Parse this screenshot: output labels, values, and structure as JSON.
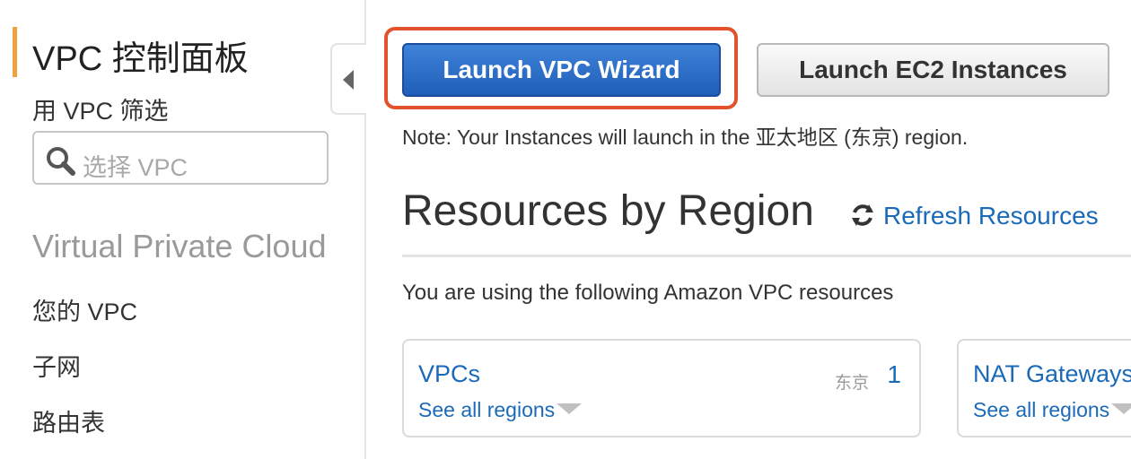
{
  "sidebar": {
    "title": "VPC 控制面板",
    "filter_label": "用 VPC 筛选",
    "filter_placeholder": "选择 VPC",
    "section_heading": "Virtual Private Cloud",
    "items": [
      {
        "label": "您的 VPC"
      },
      {
        "label": "子网"
      },
      {
        "label": "路由表"
      }
    ]
  },
  "main": {
    "launch_wizard_label": "Launch VPC Wizard",
    "launch_ec2_label": "Launch EC2 Instances",
    "note": "Note: Your Instances will launch in the 亚太地区 (东京) region.",
    "region_heading": "Resources by Region",
    "refresh_label": "Refresh Resources",
    "using_text": "You are using the following Amazon VPC resources",
    "cards": [
      {
        "title": "VPCs",
        "link": "See all regions",
        "region": "东京",
        "count": "1"
      },
      {
        "title": "NAT Gateways",
        "link": "See all regions"
      }
    ]
  },
  "colors": {
    "accent": "#f0a040",
    "primary_button": "#2a6ecb",
    "highlight": "#e2522c",
    "link": "#1a6ab8"
  },
  "icons": [
    "search-icon",
    "collapse-chevron-icon",
    "refresh-icon",
    "dropdown-arrow-icon"
  ]
}
